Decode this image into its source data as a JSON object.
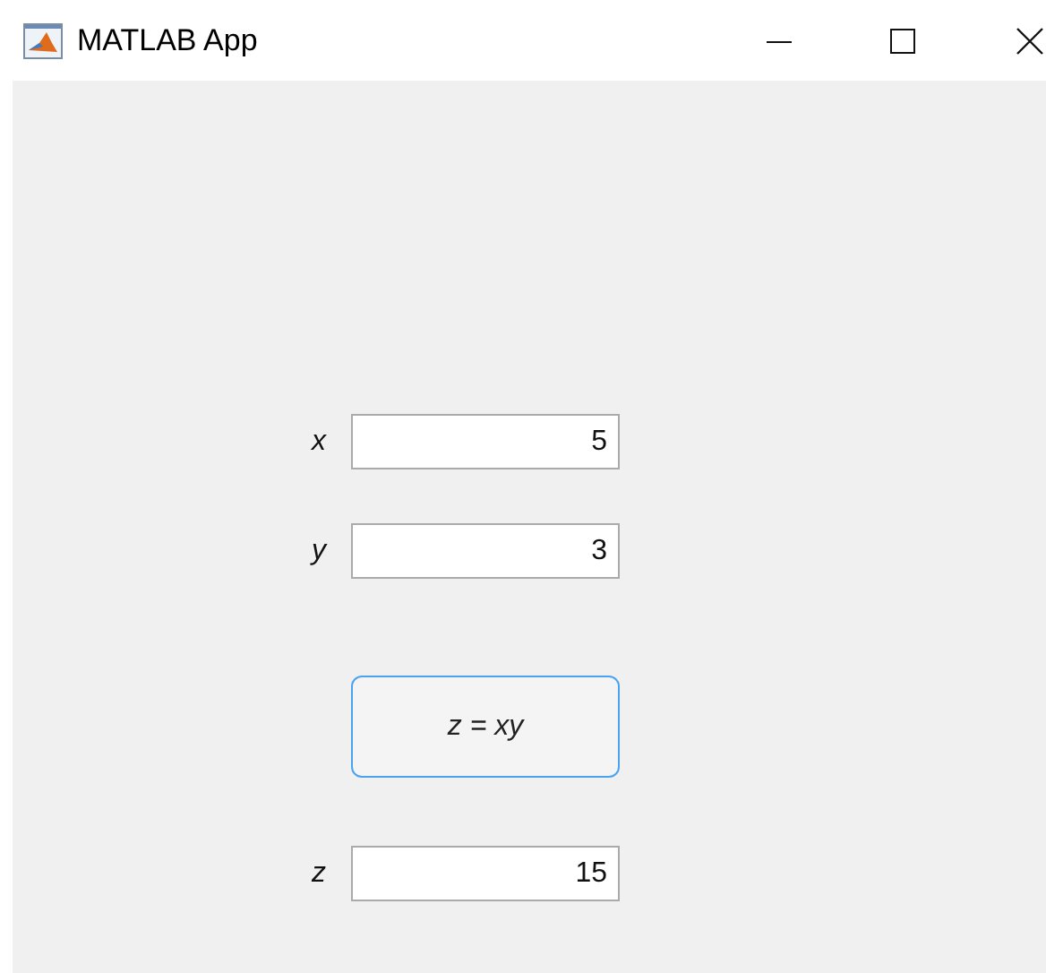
{
  "window": {
    "title": "MATLAB App"
  },
  "controls": [
    {
      "kind": "field",
      "label": "x",
      "value": "5"
    },
    {
      "kind": "field",
      "label": "y",
      "value": "3"
    },
    {
      "kind": "button",
      "label": "z = xy"
    },
    {
      "kind": "field",
      "label": "z",
      "value": "15"
    }
  ]
}
